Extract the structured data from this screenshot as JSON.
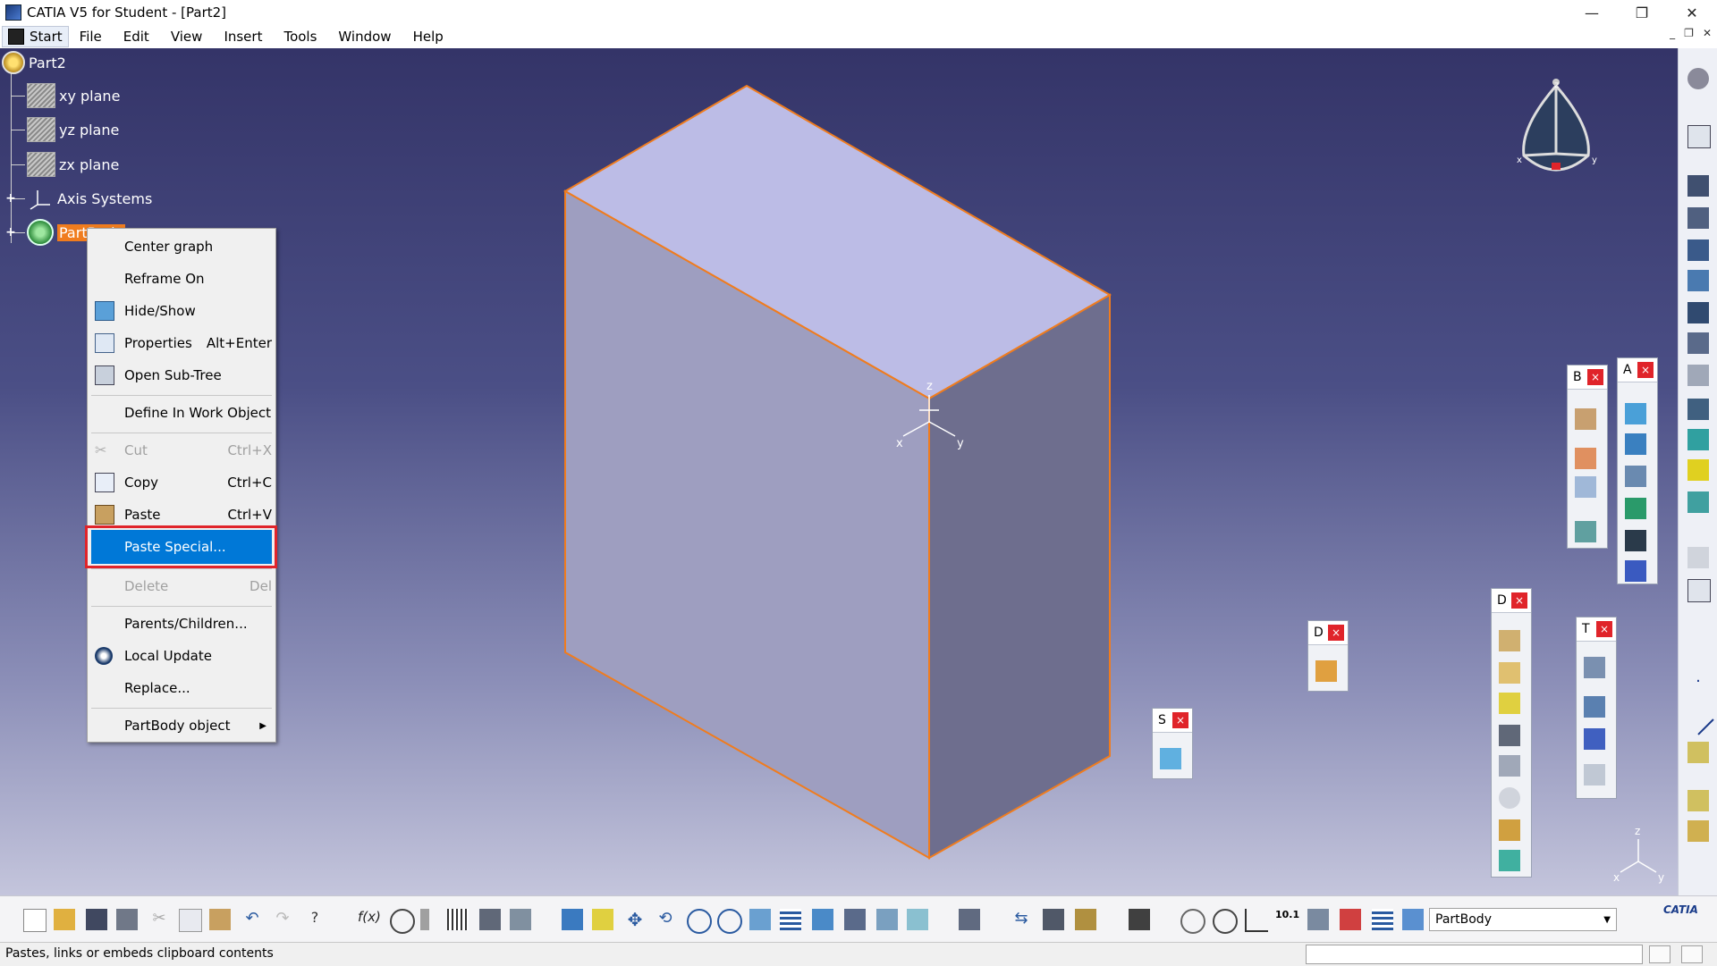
{
  "window": {
    "title": "CATIA V5 for Student - [Part2]",
    "controls": [
      "—",
      "❐",
      "✕"
    ]
  },
  "menubar": {
    "start": "Start",
    "items": [
      "File",
      "Edit",
      "View",
      "Insert",
      "Tools",
      "Window",
      "Help"
    ],
    "mdi_controls": [
      "_",
      "❐",
      "✕"
    ]
  },
  "tree": {
    "root": "Part2",
    "items": [
      {
        "label": "xy plane",
        "icon": "plane-icon"
      },
      {
        "label": "yz plane",
        "icon": "plane-icon"
      },
      {
        "label": "zx plane",
        "icon": "plane-icon"
      },
      {
        "label": "Axis Systems",
        "icon": "axis-system-icon"
      },
      {
        "label": "PartBody",
        "icon": "partbody-icon",
        "selected": true
      }
    ],
    "expander": "+"
  },
  "context_menu": {
    "items": [
      {
        "label": "Center graph",
        "shortcut": "",
        "icon": "",
        "disabled": false
      },
      {
        "label": "Reframe On",
        "shortcut": "",
        "icon": "",
        "disabled": false
      },
      {
        "label": "Hide/Show",
        "shortcut": "",
        "icon": "hide-show-icon",
        "disabled": false
      },
      {
        "label": "Properties",
        "shortcut": "Alt+Enter",
        "icon": "properties-icon",
        "disabled": false
      },
      {
        "label": "Open Sub-Tree",
        "shortcut": "",
        "icon": "open-subtree-icon",
        "disabled": false
      },
      {
        "label": "Define In Work Object",
        "shortcut": "",
        "icon": "",
        "disabled": false
      },
      {
        "label": "Cut",
        "shortcut": "Ctrl+X",
        "icon": "scissors-icon",
        "disabled": true
      },
      {
        "label": "Copy",
        "shortcut": "Ctrl+C",
        "icon": "copy-icon",
        "disabled": false
      },
      {
        "label": "Paste",
        "shortcut": "Ctrl+V",
        "icon": "paste-icon",
        "disabled": false
      },
      {
        "label": "Paste Special...",
        "shortcut": "",
        "icon": "",
        "disabled": false,
        "highlighted": true
      },
      {
        "label": "Delete",
        "shortcut": "Del",
        "icon": "",
        "disabled": true
      },
      {
        "label": "Parents/Children...",
        "shortcut": "",
        "icon": "",
        "disabled": false
      },
      {
        "label": "Local Update",
        "shortcut": "",
        "icon": "local-update-icon",
        "disabled": false
      },
      {
        "label": "Replace...",
        "shortcut": "",
        "icon": "",
        "disabled": false
      },
      {
        "label": "PartBody object",
        "shortcut": "",
        "icon": "",
        "disabled": false,
        "submenu": true
      }
    ],
    "submenu_arrow": "▶"
  },
  "viewport": {
    "axis_labels": {
      "x": "x",
      "y": "y",
      "z": "z"
    },
    "compass_labels": {
      "x": "x",
      "y": "y",
      "z": "z"
    }
  },
  "palettes": [
    {
      "id": "B",
      "title": "B"
    },
    {
      "id": "A",
      "title": "A"
    },
    {
      "id": "D1",
      "title": "D"
    },
    {
      "id": "D2",
      "title": "D"
    },
    {
      "id": "T",
      "title": "T"
    },
    {
      "id": "S",
      "title": "S"
    }
  ],
  "palette_close": "×",
  "bottom_toolbar": {
    "workbench_select": "PartBody",
    "dropdown_arrow": "▼",
    "logo": "CATIA"
  },
  "status": {
    "message": "Pastes, links or embeds clipboard contents"
  },
  "colors": {
    "viewport_top": "#343468",
    "solid_top": "#bcbce6",
    "solid_front": "#9e9ec0",
    "solid_side": "#6e6e8e",
    "edge_highlight": "#f07c1e",
    "menu_highlight": "#0078d7",
    "annotation_box": "#e0242a"
  }
}
